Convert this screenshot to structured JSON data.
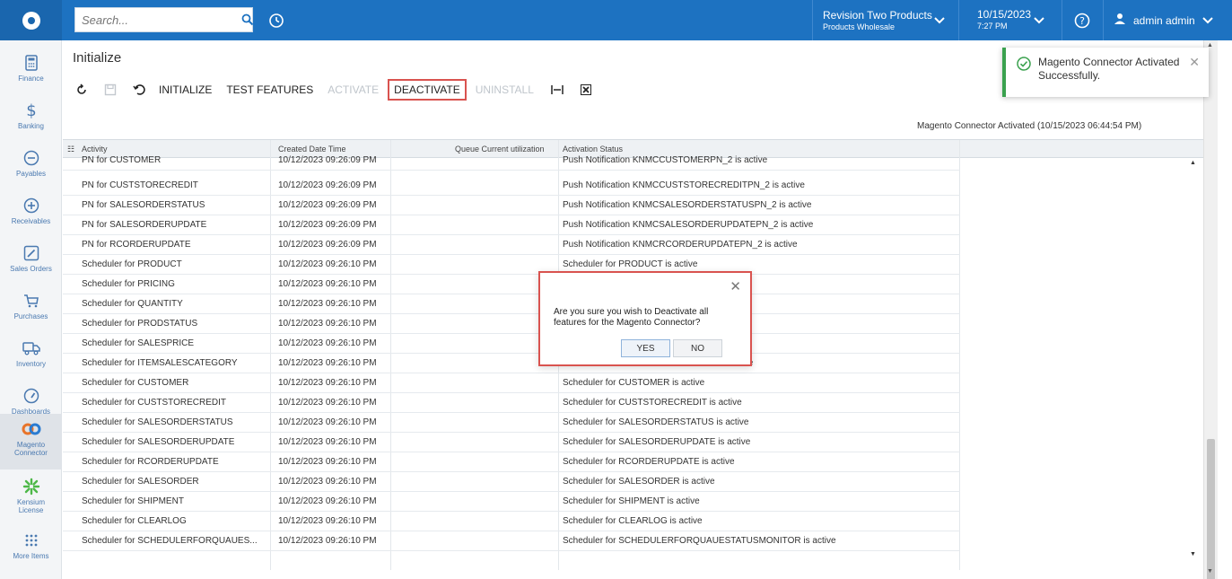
{
  "topbar": {
    "logo_icon": "acumatica-logo-icon",
    "search_placeholder": "Search...",
    "tenant_line1": "Revision Two Products",
    "tenant_line2": "Products Wholesale",
    "date": "10/15/2023",
    "time": "7:27 PM",
    "user": "admin admin"
  },
  "sidebar": {
    "items": [
      {
        "label": "Finance",
        "icon": "calculator-icon"
      },
      {
        "label": "Banking",
        "icon": "dollar-icon"
      },
      {
        "label": "Payables",
        "icon": "minus-circle-icon"
      },
      {
        "label": "Receivables",
        "icon": "plus-circle-icon"
      },
      {
        "label": "Sales Orders",
        "icon": "pencil-square-icon"
      },
      {
        "label": "Purchases",
        "icon": "cart-icon"
      },
      {
        "label": "Inventory",
        "icon": "truck-icon"
      },
      {
        "label": "Dashboards",
        "icon": "gauge-icon"
      },
      {
        "label": "Magento Connector",
        "icon": "magento-connector-icon"
      },
      {
        "label": "Kensium License",
        "icon": "kensium-icon"
      },
      {
        "label": "More Items",
        "icon": "grid-dots-icon"
      }
    ]
  },
  "page": {
    "title": "Initialize",
    "status_line": "Magento Connector Activated (10/15/2023 06:44:54 PM)"
  },
  "toolbar": {
    "initialize": "INITIALIZE",
    "test_features": "TEST FEATURES",
    "activate": "ACTIVATE",
    "deactivate": "DEACTIVATE",
    "uninstall": "UNINSTALL"
  },
  "grid": {
    "columns": {
      "activity": "Activity",
      "created": "Created Date Time",
      "queue": "Queue Current utilization",
      "status": "Activation Status"
    },
    "rows": [
      {
        "activity": "PN for CUSTOMER",
        "created": "10/12/2023 09:26:09 PM",
        "status": "Push Notification KNMCCUSTOMERPN_2 is active"
      },
      {
        "activity": "PN for CUSTSTORECREDIT",
        "created": "10/12/2023 09:26:09 PM",
        "status": "Push Notification KNMCCUSTSTORECREDITPN_2 is active"
      },
      {
        "activity": "PN for SALESORDERSTATUS",
        "created": "10/12/2023 09:26:09 PM",
        "status": "Push Notification KNMCSALESORDERSTATUSPN_2 is active"
      },
      {
        "activity": "PN for SALESORDERUPDATE",
        "created": "10/12/2023 09:26:09 PM",
        "status": "Push Notification KNMCSALESORDERUPDATEPN_2 is active"
      },
      {
        "activity": "PN for RCORDERUPDATE",
        "created": "10/12/2023 09:26:09 PM",
        "status": "Push Notification KNMCRCORDERUPDATEPN_2 is active"
      },
      {
        "activity": "Scheduler for PRODUCT",
        "created": "10/12/2023 09:26:10 PM",
        "status": "Scheduler for PRODUCT is active"
      },
      {
        "activity": "Scheduler for PRICING",
        "created": "10/12/2023 09:26:10 PM",
        "status": ""
      },
      {
        "activity": "Scheduler for QUANTITY",
        "created": "10/12/2023 09:26:10 PM",
        "status": ""
      },
      {
        "activity": "Scheduler for PRODSTATUS",
        "created": "10/12/2023 09:26:10 PM",
        "status": ""
      },
      {
        "activity": "Scheduler for SALESPRICE",
        "created": "10/12/2023 09:26:10 PM",
        "status": ""
      },
      {
        "activity": "Scheduler for ITEMSALESCATEGORY",
        "created": "10/12/2023 09:26:10 PM",
        "status": "Scheduler for ITEMSALESCATEGORY is active"
      },
      {
        "activity": "Scheduler for CUSTOMER",
        "created": "10/12/2023 09:26:10 PM",
        "status": "Scheduler for CUSTOMER is active"
      },
      {
        "activity": "Scheduler for CUSTSTORECREDIT",
        "created": "10/12/2023 09:26:10 PM",
        "status": "Scheduler for CUSTSTORECREDIT is active"
      },
      {
        "activity": "Scheduler for SALESORDERSTATUS",
        "created": "10/12/2023 09:26:10 PM",
        "status": "Scheduler for SALESORDERSTATUS is active"
      },
      {
        "activity": "Scheduler for SALESORDERUPDATE",
        "created": "10/12/2023 09:26:10 PM",
        "status": "Scheduler for SALESORDERUPDATE is active"
      },
      {
        "activity": "Scheduler for RCORDERUPDATE",
        "created": "10/12/2023 09:26:10 PM",
        "status": "Scheduler for RCORDERUPDATE is active"
      },
      {
        "activity": "Scheduler for SALESORDER",
        "created": "10/12/2023 09:26:10 PM",
        "status": "Scheduler for SALESORDER is active"
      },
      {
        "activity": "Scheduler for SHIPMENT",
        "created": "10/12/2023 09:26:10 PM",
        "status": "Scheduler for SHIPMENT is active"
      },
      {
        "activity": "Scheduler for CLEARLOG",
        "created": "10/12/2023 09:26:10 PM",
        "status": "Scheduler for CLEARLOG is active"
      },
      {
        "activity": "Scheduler for SCHEDULERFORQUAUES...",
        "created": "10/12/2023 09:26:10 PM",
        "status": "Scheduler for SCHEDULERFORQUAUESTATUSMONITOR is active"
      }
    ]
  },
  "toast": {
    "message": "Magento Connector Activated Successfully."
  },
  "dialog": {
    "message": "Are you sure you wish to Deactivate all features for the Magento Connector?",
    "yes": "YES",
    "no": "NO"
  },
  "colors": {
    "topbar": "#1d72c1",
    "accent_red": "#d9534f",
    "success_green": "#3aa14e"
  }
}
